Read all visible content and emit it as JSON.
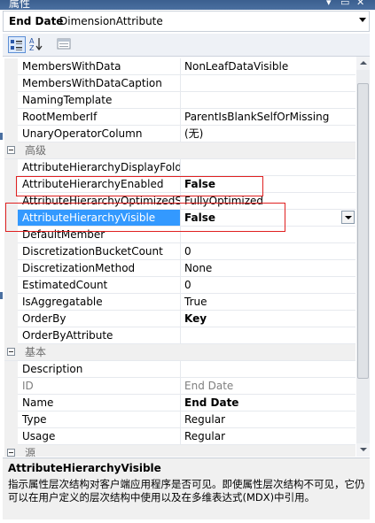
{
  "window": {
    "title": "属性"
  },
  "object": {
    "name": "End Date",
    "type": "DimensionAttribute"
  },
  "rows": [
    {
      "kind": "prop",
      "name": "MembersWithData",
      "value": "NonLeafDataVisible"
    },
    {
      "kind": "prop",
      "name": "MembersWithDataCaption",
      "value": ""
    },
    {
      "kind": "prop",
      "name": "NamingTemplate",
      "value": ""
    },
    {
      "kind": "prop",
      "name": "RootMemberIf",
      "value": "ParentIsBlankSelfOrMissing"
    },
    {
      "kind": "prop",
      "name": "UnaryOperatorColumn",
      "value": "(无)"
    },
    {
      "kind": "cat",
      "name": "高级"
    },
    {
      "kind": "prop",
      "name": "AttributeHierarchyDisplayFolder",
      "value": ""
    },
    {
      "kind": "prop",
      "name": "AttributeHierarchyEnabled",
      "value": "False",
      "bold": true
    },
    {
      "kind": "prop",
      "name": "AttributeHierarchyOptimizedState",
      "value": "FullyOptimized"
    },
    {
      "kind": "prop",
      "name": "AttributeHierarchyVisible",
      "value": "False",
      "bold": true,
      "selected": true
    },
    {
      "kind": "prop",
      "name": "DefaultMember",
      "value": ""
    },
    {
      "kind": "prop",
      "name": "DiscretizationBucketCount",
      "value": "0"
    },
    {
      "kind": "prop",
      "name": "DiscretizationMethod",
      "value": "None"
    },
    {
      "kind": "prop",
      "name": "EstimatedCount",
      "value": "0"
    },
    {
      "kind": "prop",
      "name": "IsAggregatable",
      "value": "True"
    },
    {
      "kind": "prop",
      "name": "OrderBy",
      "value": "Key",
      "bold": true
    },
    {
      "kind": "prop",
      "name": "OrderByAttribute",
      "value": ""
    },
    {
      "kind": "cat",
      "name": "基本"
    },
    {
      "kind": "prop",
      "name": "Description",
      "value": ""
    },
    {
      "kind": "prop",
      "name": "ID",
      "value": "End Date",
      "grey": true
    },
    {
      "kind": "prop",
      "name": "Name",
      "value": "End Date",
      "bold": true
    },
    {
      "kind": "prop",
      "name": "Type",
      "value": "Regular"
    },
    {
      "kind": "prop",
      "name": "Usage",
      "value": "Regular"
    },
    {
      "kind": "cat",
      "name": "源"
    }
  ],
  "description": {
    "title": "AttributeHierarchyVisible",
    "text": "指示属性层次结构对客户端应用程序是否可见。即使属性层次结构不可见，它仍可以在用户定义的层次结构中使用以及在多维表达式(MDX)中引用。"
  },
  "icons": {
    "categorized": "categorized-icon",
    "alphabetical": "alphabetical-sort-icon",
    "property_pages": "property-pages-icon"
  }
}
